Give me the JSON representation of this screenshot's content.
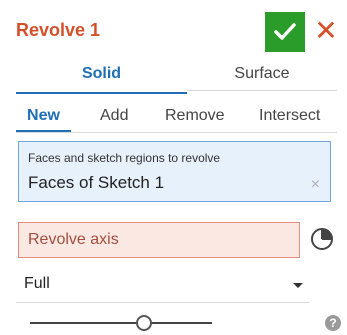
{
  "header": {
    "title": "Revolve 1",
    "confirm_icon": "checkmark-icon",
    "close_icon": "close-icon",
    "close_glyph": "✕"
  },
  "type_tabs": [
    {
      "label": "Solid",
      "active": true
    },
    {
      "label": "Surface",
      "active": false
    }
  ],
  "operation_tabs": [
    {
      "label": "New",
      "active": true
    },
    {
      "label": "Add",
      "active": false
    },
    {
      "label": "Remove",
      "active": false
    },
    {
      "label": "Intersect",
      "active": false
    }
  ],
  "faces_field": {
    "label": "Faces and sketch regions to revolve",
    "value": "Faces of Sketch 1",
    "clear_glyph": "×"
  },
  "axis_field": {
    "placeholder": "Revolve axis",
    "icon": "clock-icon"
  },
  "revolve_type": {
    "selected": "Full"
  },
  "slider": {
    "position_fraction": 0.58
  },
  "help": {
    "glyph": "?",
    "icon": "help-icon"
  },
  "colors": {
    "title": "#d4502b",
    "accent": "#1e6fb5",
    "confirm": "#2a9c2a",
    "selection_fill": "#e7f1fb",
    "error_fill": "#fbe8e3"
  }
}
